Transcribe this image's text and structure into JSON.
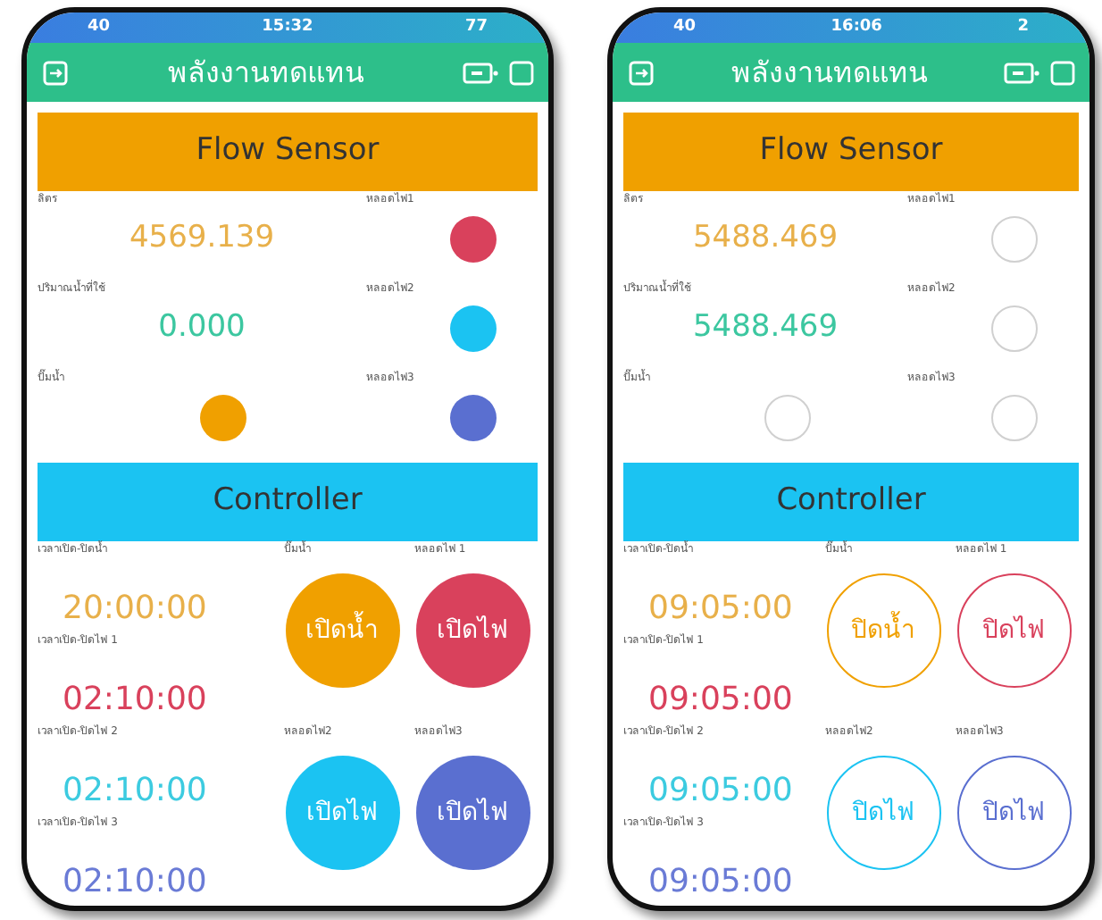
{
  "phones": [
    {
      "status_bar": {
        "signal": "40",
        "time": "15:32",
        "battery": "77"
      },
      "title": "พลังงานทดแทน",
      "flow_sensor": {
        "title": "Flow Sensor",
        "widgets": [
          {
            "kind": "value",
            "label": "ลิตร",
            "value": "4569.139",
            "color": "#e8b04a"
          },
          {
            "kind": "led",
            "label": "หลอดไฟ1",
            "on": true,
            "color": "#d9415c"
          },
          {
            "kind": "value",
            "label": "ปริมาณน้ำที่ใช้",
            "value": "0.000",
            "color": "#3cc7a0"
          },
          {
            "kind": "led",
            "label": "หลอดไฟ2",
            "on": true,
            "color": "#1bc3f2"
          },
          {
            "kind": "led",
            "label": "ปั๊มน้ำ",
            "on": true,
            "color": "#f0a000"
          },
          {
            "kind": "led",
            "label": "หลอดไฟ3",
            "on": true,
            "color": "#5a6fd0"
          }
        ]
      },
      "controller": {
        "title": "Controller",
        "timers": [
          {
            "label": "เวลาเปิด-ปิดน้ำ",
            "time": "20:00:00",
            "color": "#e8b04a"
          },
          {
            "label": "เวลาเปิด-ปิดไฟ 1",
            "time": "02:10:00",
            "color": "#d9415c"
          },
          {
            "label": "เวลาเปิด-ปิดไฟ 2",
            "time": "02:10:00",
            "color": "#3ccbe0"
          },
          {
            "label": "เวลาเปิด-ปิดไฟ 3",
            "time": "02:10:00",
            "color": "#6a7bd6"
          }
        ],
        "buttons": [
          {
            "label": "ปั๊มน้ำ",
            "text": "เปิดน้ำ",
            "on": true,
            "color": "#f0a000"
          },
          {
            "label": "หลอดไฟ 1",
            "text": "เปิดไฟ",
            "on": true,
            "color": "#d9415c"
          },
          {
            "label": "หลอดไฟ2",
            "text": "เปิดไฟ",
            "on": true,
            "color": "#1bc3f2"
          },
          {
            "label": "หลอดไฟ3",
            "text": "เปิดไฟ",
            "on": true,
            "color": "#5a6fd0"
          }
        ]
      }
    },
    {
      "status_bar": {
        "signal": "40",
        "time": "16:06",
        "battery": "2"
      },
      "title": "พลังงานทดแทน",
      "flow_sensor": {
        "title": "Flow Sensor",
        "widgets": [
          {
            "kind": "value",
            "label": "ลิตร",
            "value": "5488.469",
            "color": "#e8b04a"
          },
          {
            "kind": "led",
            "label": "หลอดไฟ1",
            "on": false
          },
          {
            "kind": "value",
            "label": "ปริมาณน้ำที่ใช้",
            "value": "5488.469",
            "color": "#3cc7a0"
          },
          {
            "kind": "led",
            "label": "หลอดไฟ2",
            "on": false
          },
          {
            "kind": "led",
            "label": "ปั๊มน้ำ",
            "on": false
          },
          {
            "kind": "led",
            "label": "หลอดไฟ3",
            "on": false
          }
        ]
      },
      "controller": {
        "title": "Controller",
        "timers": [
          {
            "label": "เวลาเปิด-ปิดน้ำ",
            "time": "09:05:00",
            "color": "#e8b04a"
          },
          {
            "label": "เวลาเปิด-ปิดไฟ 1",
            "time": "09:05:00",
            "color": "#d9415c"
          },
          {
            "label": "เวลาเปิด-ปิดไฟ 2",
            "time": "09:05:00",
            "color": "#3ccbe0"
          },
          {
            "label": "เวลาเปิด-ปิดไฟ 3",
            "time": "09:05:00",
            "color": "#6a7bd6"
          }
        ],
        "buttons": [
          {
            "label": "ปั๊มน้ำ",
            "text": "ปิดน้ำ",
            "on": false,
            "color": "#f0a000"
          },
          {
            "label": "หลอดไฟ 1",
            "text": "ปิดไฟ",
            "on": false,
            "color": "#d9415c"
          },
          {
            "label": "หลอดไฟ2",
            "text": "ปิดไฟ",
            "on": false,
            "color": "#1bc3f2"
          },
          {
            "label": "หลอดไฟ3",
            "text": "ปิดไฟ",
            "on": false,
            "color": "#5a6fd0"
          }
        ]
      }
    }
  ]
}
